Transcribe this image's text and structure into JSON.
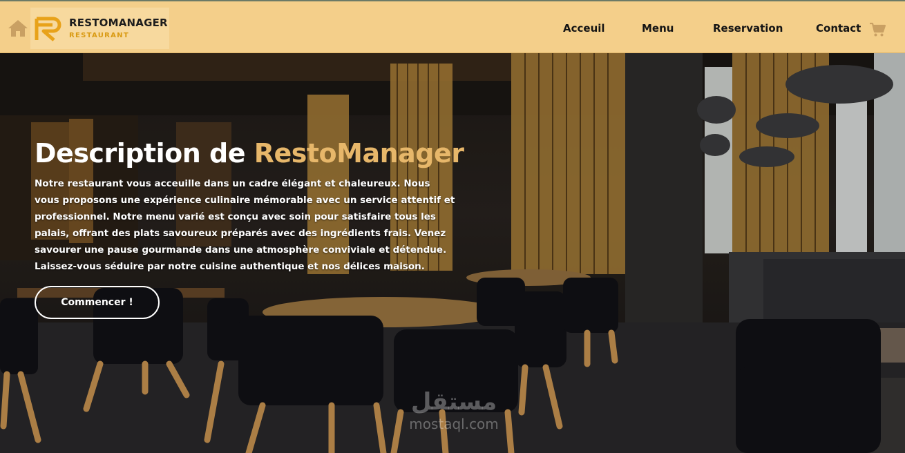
{
  "header": {
    "brand": {
      "title": "RESTOMANAGER",
      "subtitle": "RESTAURANT",
      "icon": "restomanager-logo-mark"
    },
    "home_icon": "home-icon",
    "nav": [
      {
        "label": "Acceuil"
      },
      {
        "label": "Menu"
      },
      {
        "label": "Reservation"
      },
      {
        "label": "Contact"
      }
    ],
    "cart_icon": "shopping-cart-icon"
  },
  "hero": {
    "title_prefix": "Description de ",
    "title_accent": "RestoManager",
    "description": "Notre restaurant vous acceuille dans un cadre élégant et chaleureux. Nous vous proposons une expérience culinaire mémorable avec un service attentif et professionnel. Notre menu varié est conçu avec soin pour satisfaire tous les palais, offrant des plats savoureux préparés avec des ingrédients frais. Venez savourer une pause gourmande dans une atmosphère conviviale et détendue. Laissez-vous séduire par notre cuisine authentique et nos délices maison.",
    "cta_label": "Commencer !",
    "background": "restaurant-interior-photo"
  },
  "watermark": {
    "arabic": "مستقل",
    "latin": "mostaql.com"
  },
  "colors": {
    "header_bg": "#f4cf8a",
    "logo_box_bg": "#f7d99e",
    "accent": "#e7b76a",
    "logo_gold": "#e8a21a",
    "text_dark": "#141414",
    "icon_tan": "#c9a063"
  }
}
